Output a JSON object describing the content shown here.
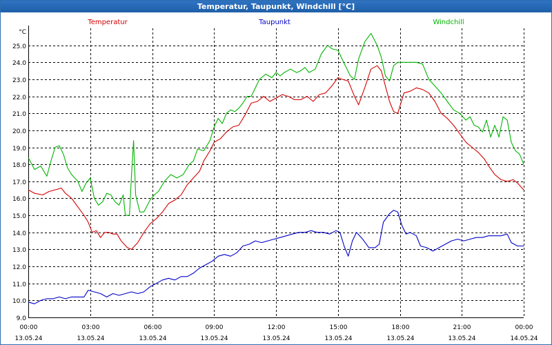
{
  "window": {
    "title": "Temperatur, Taupunkt, Windchill [°C]"
  },
  "chart_data": {
    "type": "line",
    "title": "Temperatur, Taupunkt, Windchill [°C]",
    "ylabel": "°C",
    "ylim": [
      9.0,
      26.0
    ],
    "yticks": [
      9.0,
      10.0,
      11.0,
      12.0,
      13.0,
      14.0,
      15.0,
      16.0,
      17.0,
      18.0,
      19.0,
      20.0,
      21.0,
      22.0,
      23.0,
      24.0,
      25.0
    ],
    "xlim": [
      0,
      24
    ],
    "xticks": [
      {
        "hour": 0,
        "time": "00:00",
        "date": "13.05.24"
      },
      {
        "hour": 3,
        "time": "03:00",
        "date": "13.05.24"
      },
      {
        "hour": 6,
        "time": "06:00",
        "date": "13.05.24"
      },
      {
        "hour": 9,
        "time": "09:00",
        "date": "13.05.24"
      },
      {
        "hour": 12,
        "time": "12:00",
        "date": "13.05.24"
      },
      {
        "hour": 15,
        "time": "15:00",
        "date": "13.05.24"
      },
      {
        "hour": 18,
        "time": "18:00",
        "date": "13.05.24"
      },
      {
        "hour": 21,
        "time": "21:00",
        "date": "13.05.24"
      },
      {
        "hour": 24,
        "time": "00:00",
        "date": "14.05.24"
      }
    ],
    "grid": true,
    "legend_position": "top",
    "series": [
      {
        "name": "Temperatur",
        "color": "#d40000",
        "points": [
          [
            0.0,
            16.5
          ],
          [
            0.3,
            16.3
          ],
          [
            0.7,
            16.2
          ],
          [
            1.0,
            16.4
          ],
          [
            1.3,
            16.5
          ],
          [
            1.6,
            16.6
          ],
          [
            1.8,
            16.3
          ],
          [
            2.1,
            16.0
          ],
          [
            2.4,
            15.5
          ],
          [
            2.7,
            15.0
          ],
          [
            2.9,
            14.6
          ],
          [
            3.1,
            14.0
          ],
          [
            3.3,
            14.1
          ],
          [
            3.5,
            13.7
          ],
          [
            3.7,
            14.0
          ],
          [
            3.9,
            14.0
          ],
          [
            4.1,
            13.9
          ],
          [
            4.3,
            13.9
          ],
          [
            4.5,
            13.5
          ],
          [
            4.8,
            13.1
          ],
          [
            5.0,
            13.0
          ],
          [
            5.3,
            13.4
          ],
          [
            5.6,
            14.0
          ],
          [
            5.9,
            14.5
          ],
          [
            6.2,
            14.8
          ],
          [
            6.5,
            15.2
          ],
          [
            6.8,
            15.7
          ],
          [
            7.1,
            15.9
          ],
          [
            7.4,
            16.2
          ],
          [
            7.7,
            16.8
          ],
          [
            8.0,
            17.2
          ],
          [
            8.3,
            17.6
          ],
          [
            8.5,
            18.2
          ],
          [
            8.8,
            18.8
          ],
          [
            9.0,
            19.3
          ],
          [
            9.3,
            19.5
          ],
          [
            9.6,
            19.9
          ],
          [
            9.9,
            20.2
          ],
          [
            10.2,
            20.3
          ],
          [
            10.5,
            20.9
          ],
          [
            10.8,
            21.6
          ],
          [
            11.1,
            21.7
          ],
          [
            11.4,
            22.0
          ],
          [
            11.7,
            21.7
          ],
          [
            12.0,
            21.9
          ],
          [
            12.3,
            22.1
          ],
          [
            12.6,
            22.0
          ],
          [
            12.9,
            21.8
          ],
          [
            13.2,
            21.8
          ],
          [
            13.5,
            22.0
          ],
          [
            13.8,
            21.7
          ],
          [
            14.1,
            22.1
          ],
          [
            14.4,
            22.2
          ],
          [
            14.7,
            22.6
          ],
          [
            15.0,
            23.1
          ],
          [
            15.2,
            23.0
          ],
          [
            15.5,
            22.9
          ],
          [
            15.8,
            22.0
          ],
          [
            16.0,
            21.5
          ],
          [
            16.3,
            22.5
          ],
          [
            16.6,
            23.6
          ],
          [
            16.9,
            23.8
          ],
          [
            17.1,
            23.5
          ],
          [
            17.3,
            22.6
          ],
          [
            17.5,
            21.7
          ],
          [
            17.7,
            21.1
          ],
          [
            17.9,
            21.0
          ],
          [
            18.2,
            22.2
          ],
          [
            18.5,
            22.3
          ],
          [
            18.8,
            22.5
          ],
          [
            19.1,
            22.4
          ],
          [
            19.4,
            22.2
          ],
          [
            19.7,
            21.7
          ],
          [
            20.0,
            21.0
          ],
          [
            20.3,
            20.7
          ],
          [
            20.6,
            20.3
          ],
          [
            20.9,
            19.8
          ],
          [
            21.2,
            19.3
          ],
          [
            21.5,
            19.0
          ],
          [
            21.8,
            18.7
          ],
          [
            22.1,
            18.3
          ],
          [
            22.3,
            17.9
          ],
          [
            22.6,
            17.4
          ],
          [
            22.9,
            17.1
          ],
          [
            23.2,
            17.0
          ],
          [
            23.5,
            17.1
          ],
          [
            23.7,
            16.9
          ],
          [
            24.0,
            16.5
          ]
        ]
      },
      {
        "name": "Taupunkt",
        "color": "#0000c8",
        "points": [
          [
            0.0,
            9.9
          ],
          [
            0.3,
            9.8
          ],
          [
            0.6,
            10.0
          ],
          [
            0.9,
            10.1
          ],
          [
            1.2,
            10.1
          ],
          [
            1.5,
            10.2
          ],
          [
            1.8,
            10.1
          ],
          [
            2.1,
            10.2
          ],
          [
            2.4,
            10.2
          ],
          [
            2.7,
            10.2
          ],
          [
            2.9,
            10.6
          ],
          [
            3.2,
            10.5
          ],
          [
            3.5,
            10.4
          ],
          [
            3.8,
            10.2
          ],
          [
            4.1,
            10.4
          ],
          [
            4.4,
            10.3
          ],
          [
            4.7,
            10.4
          ],
          [
            5.0,
            10.5
          ],
          [
            5.3,
            10.4
          ],
          [
            5.6,
            10.5
          ],
          [
            5.9,
            10.8
          ],
          [
            6.2,
            11.0
          ],
          [
            6.5,
            11.2
          ],
          [
            6.8,
            11.3
          ],
          [
            7.1,
            11.2
          ],
          [
            7.4,
            11.4
          ],
          [
            7.7,
            11.4
          ],
          [
            8.0,
            11.6
          ],
          [
            8.3,
            11.9
          ],
          [
            8.6,
            12.1
          ],
          [
            8.9,
            12.3
          ],
          [
            9.2,
            12.6
          ],
          [
            9.5,
            12.7
          ],
          [
            9.8,
            12.6
          ],
          [
            10.1,
            12.8
          ],
          [
            10.4,
            13.2
          ],
          [
            10.7,
            13.3
          ],
          [
            11.0,
            13.5
          ],
          [
            11.3,
            13.4
          ],
          [
            11.6,
            13.5
          ],
          [
            11.9,
            13.6
          ],
          [
            12.2,
            13.7
          ],
          [
            12.5,
            13.8
          ],
          [
            12.8,
            13.9
          ],
          [
            13.1,
            14.0
          ],
          [
            13.4,
            14.0
          ],
          [
            13.7,
            14.1
          ],
          [
            14.0,
            14.0
          ],
          [
            14.3,
            14.0
          ],
          [
            14.6,
            13.9
          ],
          [
            14.9,
            14.1
          ],
          [
            15.1,
            14.0
          ],
          [
            15.3,
            13.2
          ],
          [
            15.5,
            12.6
          ],
          [
            15.7,
            13.5
          ],
          [
            15.9,
            14.0
          ],
          [
            16.2,
            13.6
          ],
          [
            16.5,
            13.1
          ],
          [
            16.8,
            13.1
          ],
          [
            17.0,
            13.3
          ],
          [
            17.2,
            14.6
          ],
          [
            17.5,
            15.1
          ],
          [
            17.7,
            15.3
          ],
          [
            17.9,
            15.2
          ],
          [
            18.1,
            14.4
          ],
          [
            18.3,
            13.9
          ],
          [
            18.5,
            14.0
          ],
          [
            18.8,
            13.8
          ],
          [
            19.0,
            13.2
          ],
          [
            19.3,
            13.1
          ],
          [
            19.6,
            12.9
          ],
          [
            19.9,
            13.1
          ],
          [
            20.2,
            13.3
          ],
          [
            20.5,
            13.5
          ],
          [
            20.8,
            13.6
          ],
          [
            21.1,
            13.5
          ],
          [
            21.4,
            13.6
          ],
          [
            21.7,
            13.7
          ],
          [
            22.0,
            13.7
          ],
          [
            22.3,
            13.8
          ],
          [
            22.6,
            13.8
          ],
          [
            22.9,
            13.8
          ],
          [
            23.2,
            13.9
          ],
          [
            23.4,
            13.4
          ],
          [
            23.7,
            13.2
          ],
          [
            24.0,
            13.2
          ]
        ]
      },
      {
        "name": "Windchill",
        "color": "#00b400",
        "points": [
          [
            0.0,
            18.4
          ],
          [
            0.3,
            17.7
          ],
          [
            0.6,
            17.9
          ],
          [
            0.9,
            17.3
          ],
          [
            1.1,
            18.2
          ],
          [
            1.3,
            19.0
          ],
          [
            1.5,
            19.1
          ],
          [
            1.7,
            18.6
          ],
          [
            1.9,
            17.8
          ],
          [
            2.1,
            17.4
          ],
          [
            2.4,
            17.0
          ],
          [
            2.6,
            16.4
          ],
          [
            2.8,
            16.9
          ],
          [
            3.0,
            17.2
          ],
          [
            3.2,
            16.0
          ],
          [
            3.4,
            15.6
          ],
          [
            3.6,
            15.8
          ],
          [
            3.8,
            16.3
          ],
          [
            4.0,
            16.2
          ],
          [
            4.2,
            15.8
          ],
          [
            4.4,
            15.6
          ],
          [
            4.6,
            16.2
          ],
          [
            4.7,
            15.0
          ],
          [
            4.9,
            15.0
          ],
          [
            5.0,
            17.4
          ],
          [
            5.1,
            19.4
          ],
          [
            5.2,
            16.2
          ],
          [
            5.4,
            15.2
          ],
          [
            5.6,
            15.2
          ],
          [
            5.9,
            15.9
          ],
          [
            6.1,
            16.2
          ],
          [
            6.3,
            16.4
          ],
          [
            6.6,
            17.0
          ],
          [
            6.9,
            17.4
          ],
          [
            7.2,
            17.2
          ],
          [
            7.5,
            17.4
          ],
          [
            7.8,
            18.0
          ],
          [
            8.0,
            18.2
          ],
          [
            8.2,
            18.9
          ],
          [
            8.5,
            18.8
          ],
          [
            8.8,
            19.4
          ],
          [
            9.0,
            20.2
          ],
          [
            9.2,
            20.7
          ],
          [
            9.4,
            20.4
          ],
          [
            9.6,
            21.0
          ],
          [
            9.8,
            21.2
          ],
          [
            10.0,
            21.1
          ],
          [
            10.2,
            21.3
          ],
          [
            10.4,
            21.6
          ],
          [
            10.6,
            22.0
          ],
          [
            10.8,
            22.0
          ],
          [
            11.0,
            22.5
          ],
          [
            11.2,
            23.0
          ],
          [
            11.5,
            23.3
          ],
          [
            11.8,
            23.1
          ],
          [
            12.0,
            23.4
          ],
          [
            12.2,
            23.2
          ],
          [
            12.4,
            23.4
          ],
          [
            12.7,
            23.6
          ],
          [
            13.0,
            23.4
          ],
          [
            13.2,
            23.5
          ],
          [
            13.4,
            23.7
          ],
          [
            13.6,
            23.4
          ],
          [
            13.9,
            23.6
          ],
          [
            14.2,
            24.5
          ],
          [
            14.5,
            25.0
          ],
          [
            14.7,
            24.8
          ],
          [
            15.0,
            24.7
          ],
          [
            15.2,
            24.2
          ],
          [
            15.4,
            23.7
          ],
          [
            15.6,
            23.2
          ],
          [
            15.8,
            23.0
          ],
          [
            16.0,
            24.2
          ],
          [
            16.3,
            25.2
          ],
          [
            16.6,
            25.7
          ],
          [
            16.9,
            25.0
          ],
          [
            17.1,
            24.3
          ],
          [
            17.3,
            23.2
          ],
          [
            17.5,
            22.9
          ],
          [
            17.7,
            23.8
          ],
          [
            17.9,
            24.0
          ],
          [
            18.2,
            24.0
          ],
          [
            18.5,
            24.0
          ],
          [
            18.8,
            24.0
          ],
          [
            19.1,
            23.9
          ],
          [
            19.4,
            23.0
          ],
          [
            19.7,
            22.6
          ],
          [
            20.0,
            22.2
          ],
          [
            20.3,
            21.7
          ],
          [
            20.6,
            21.2
          ],
          [
            20.9,
            21.0
          ],
          [
            21.2,
            20.6
          ],
          [
            21.4,
            20.8
          ],
          [
            21.6,
            20.3
          ],
          [
            21.8,
            20.2
          ],
          [
            22.0,
            19.9
          ],
          [
            22.2,
            20.6
          ],
          [
            22.4,
            19.6
          ],
          [
            22.6,
            20.3
          ],
          [
            22.8,
            19.6
          ],
          [
            23.0,
            20.8
          ],
          [
            23.2,
            20.6
          ],
          [
            23.4,
            19.3
          ],
          [
            23.6,
            18.8
          ],
          [
            23.8,
            18.6
          ],
          [
            24.0,
            18.0
          ]
        ]
      }
    ]
  }
}
